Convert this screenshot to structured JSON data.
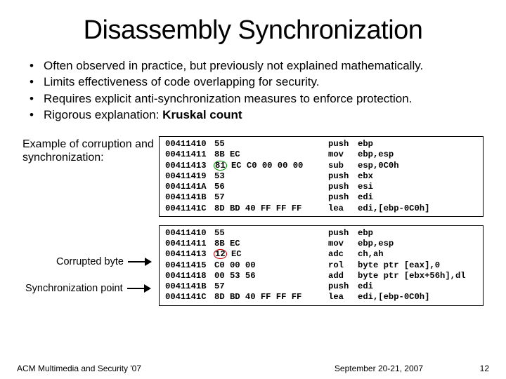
{
  "title": "Disassembly Synchronization",
  "bullets": [
    "Often observed in practice, but previously not explained mathematically.",
    "Limits effectiveness of code overlapping for security.",
    "Requires explicit anti-synchronization measures to enforce protection.",
    "Rigorous explanation: "
  ],
  "bullet4_bold": "Kruskal count",
  "example_label": "Example of corruption and synchronization:",
  "corrupted_label": "Corrupted byte",
  "sync_label": "Synchronization point",
  "code1": [
    {
      "addr": "00411410",
      "bytes_pre": "55",
      "circ": "",
      "bytes_post": "",
      "mnem": "push",
      "op": "ebp"
    },
    {
      "addr": "00411411",
      "bytes_pre": "8B EC",
      "circ": "",
      "bytes_post": "",
      "mnem": "mov",
      "op": "ebp,esp"
    },
    {
      "addr": "00411413",
      "bytes_pre": "",
      "circ": "81",
      "circ_class": "circle-green",
      "bytes_post": " EC C0 00 00 00",
      "mnem": "sub",
      "op": "esp,0C0h"
    },
    {
      "addr": "00411419",
      "bytes_pre": "53",
      "circ": "",
      "bytes_post": "",
      "mnem": "push",
      "op": "ebx"
    },
    {
      "addr": "0041141A",
      "bytes_pre": "56",
      "circ": "",
      "bytes_post": "",
      "mnem": "push",
      "op": "esi"
    },
    {
      "addr": "0041141B",
      "bytes_pre": "57",
      "circ": "",
      "bytes_post": "",
      "mnem": "push",
      "op": "edi"
    },
    {
      "addr": "0041141C",
      "bytes_pre": "8D BD 40 FF FF FF",
      "circ": "",
      "bytes_post": "",
      "mnem": "lea",
      "op": "edi,[ebp-0C0h]"
    }
  ],
  "code2": [
    {
      "addr": "00411410",
      "bytes_pre": "55",
      "circ": "",
      "bytes_post": "",
      "mnem": "push",
      "op": "ebp"
    },
    {
      "addr": "00411411",
      "bytes_pre": "8B EC",
      "circ": "",
      "bytes_post": "",
      "mnem": "mov",
      "op": "ebp,esp"
    },
    {
      "addr": "00411413",
      "bytes_pre": "",
      "circ": "12",
      "circ_class": "circle-red",
      "bytes_post": " EC",
      "mnem": "adc",
      "op": "ch,ah"
    },
    {
      "addr": "00411415",
      "bytes_pre": "C0 00 00",
      "circ": "",
      "bytes_post": "",
      "mnem": "rol",
      "op": "byte ptr [eax],0"
    },
    {
      "addr": "00411418",
      "bytes_pre": "00 53 56",
      "circ": "",
      "bytes_post": "",
      "mnem": "add",
      "op": "byte ptr [ebx+56h],dl"
    },
    {
      "addr": "0041141B",
      "bytes_pre": "57",
      "circ": "",
      "bytes_post": "",
      "mnem": "push",
      "op": "edi"
    },
    {
      "addr": "0041141C",
      "bytes_pre": "8D BD 40 FF FF FF",
      "circ": "",
      "bytes_post": "",
      "mnem": "lea",
      "op": "edi,[ebp-0C0h]"
    }
  ],
  "footer_left": "ACM Multimedia and Security '07",
  "footer_mid": "September 20-21, 2007",
  "footer_page": "12"
}
